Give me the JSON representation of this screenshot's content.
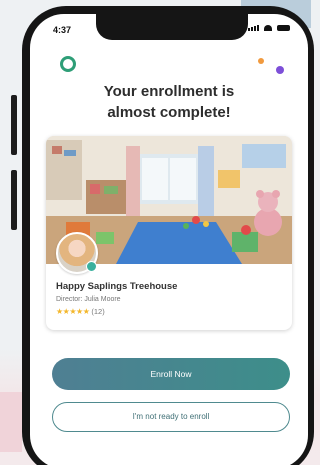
{
  "status_bar": {
    "time": "4:37",
    "icons": [
      "signal-icon",
      "wifi-icon",
      "battery-icon"
    ]
  },
  "header": {
    "logo_icon": "ring-logo-icon",
    "title_line1": "Your enrollment is",
    "title_line2": "almost complete!"
  },
  "listing": {
    "photo": "classroom-photo",
    "school_name": "Happy Saplings Treehouse",
    "director": "Director: Julia Moore",
    "stars": "★★★★★",
    "review_count": "(12)"
  },
  "actions": {
    "enroll_label": "Enroll Now",
    "not_ready_label": "I'm not ready to enroll"
  },
  "colors": {
    "accent_teal": "#3d8e8a",
    "accent_slate": "#4f7f93",
    "logo_green": "#2e9e77",
    "dot_orange": "#f19a3e",
    "dot_purple": "#7d4fd8",
    "star_yellow": "#f3b62a"
  }
}
